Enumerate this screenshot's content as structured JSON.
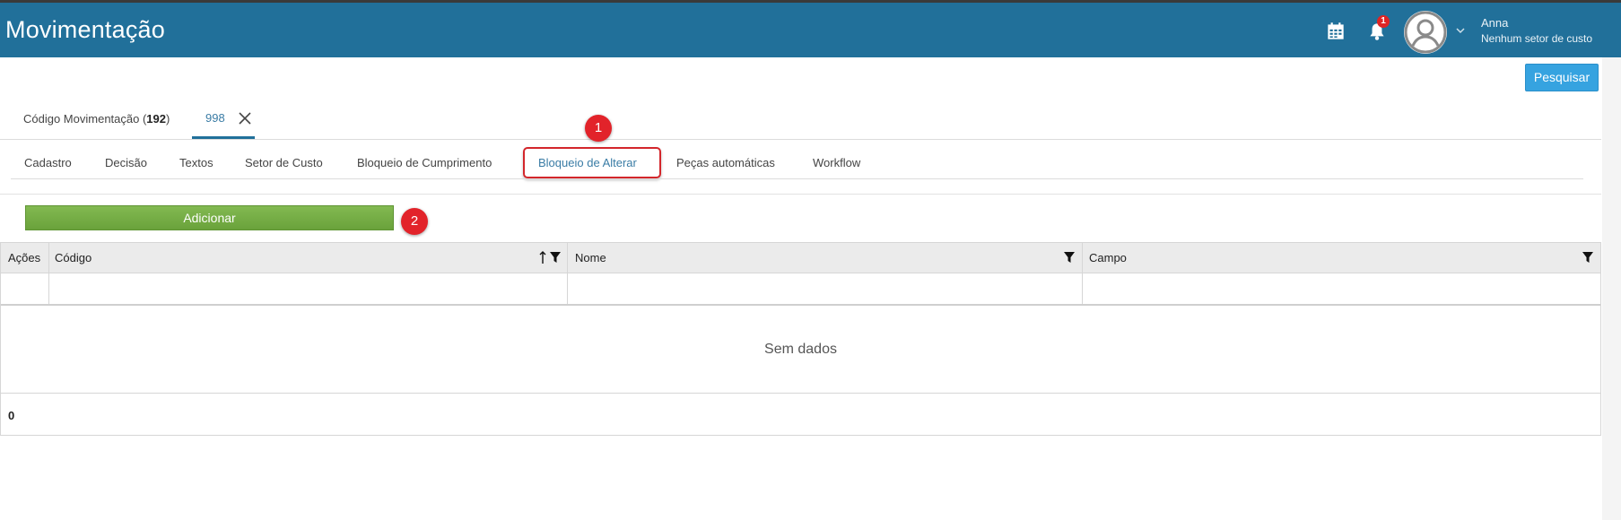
{
  "header": {
    "title": "Movimentação",
    "notification_count": "1",
    "user": {
      "name": "Anna",
      "sector": "Nenhum setor de custo"
    },
    "bg_color": "#21709a"
  },
  "toolbar": {
    "search_label": "Pesquisar"
  },
  "record_tabs": {
    "main_prefix": "Código Movimentação (",
    "main_count": "192",
    "main_suffix": ")",
    "current_id": "998"
  },
  "tabs": [
    {
      "label": "Cadastro",
      "active": false
    },
    {
      "label": "Decisão",
      "active": false
    },
    {
      "label": "Textos",
      "active": false
    },
    {
      "label": "Setor de Custo",
      "active": false
    },
    {
      "label": "Bloqueio de Cumprimento",
      "active": false
    },
    {
      "label": "Bloqueio de Alterar",
      "active": true
    },
    {
      "label": "Peças automáticas",
      "active": false
    },
    {
      "label": "Workflow",
      "active": false
    }
  ],
  "markers": [
    "1",
    "2"
  ],
  "actions": {
    "add_label": "Adicionar"
  },
  "grid": {
    "columns": [
      "Ações",
      "Código",
      "Nome",
      "Campo"
    ],
    "sort_column": "Código",
    "empty_text": "Sem dados",
    "total": "0"
  },
  "icons": [
    "calendar-icon",
    "bell-icon",
    "avatar-icon",
    "chevron-down-icon",
    "close-icon",
    "sort-asc-icon",
    "filter-icon"
  ],
  "colors": {
    "accent": "#21709a",
    "search_button": "#36a3e0",
    "add_button": "#6aa23b",
    "highlight": "#d3262b"
  }
}
